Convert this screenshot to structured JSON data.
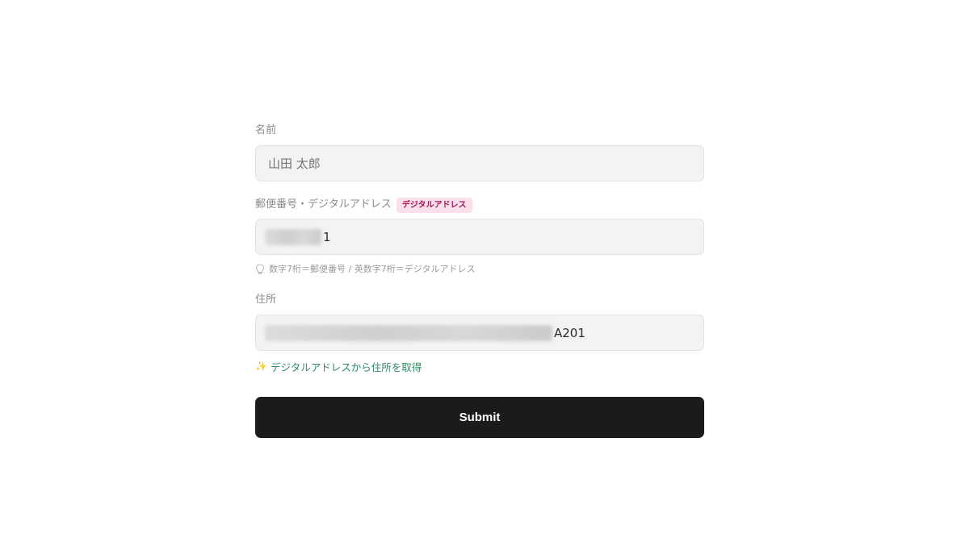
{
  "form": {
    "name": {
      "label": "名前",
      "placeholder": "山田 太郎"
    },
    "postal": {
      "label": "郵便番号・デジタルアドレス",
      "badge": "デジタルアドレス",
      "value_visible": "1",
      "hint": "数字7桁＝郵便番号 / 英数字7桁＝デジタルアドレス",
      "hint_icon": "lightbulb-icon"
    },
    "address": {
      "label": "住所",
      "value_visible": "A201"
    },
    "lookup_link": {
      "icon": "sparkles-icon",
      "label": "デジタルアドレスから住所を取得"
    },
    "submit_label": "Submit"
  },
  "colors": {
    "badge_bg": "#fbe0ec",
    "badge_text": "#a31657",
    "link": "#2f8a63",
    "submit_bg": "#1b1b1b",
    "input_bg": "#f3f3f3"
  }
}
